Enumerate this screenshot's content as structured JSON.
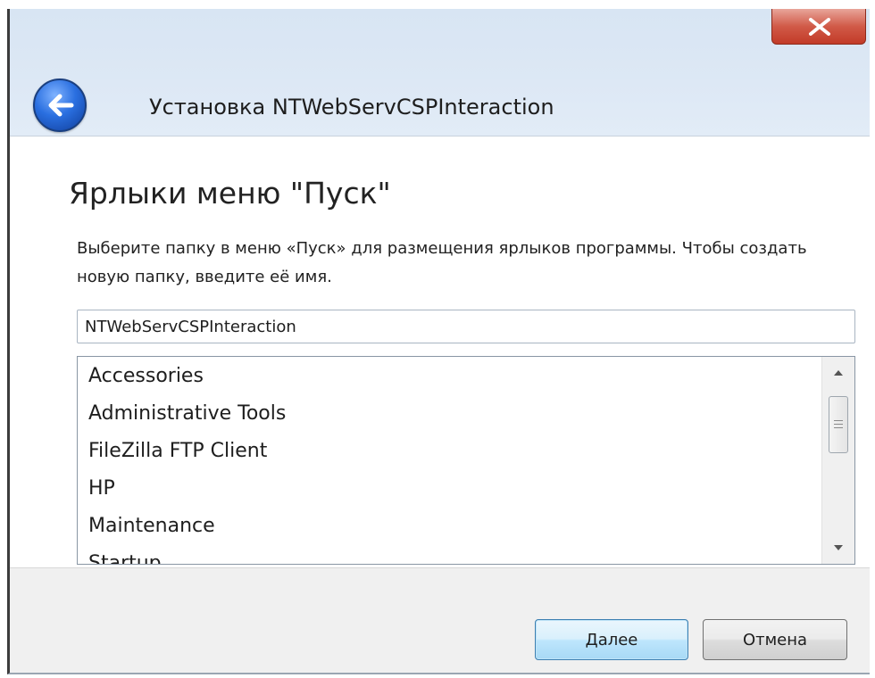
{
  "window": {
    "title": "Установка NTWebServCSPInteraction",
    "close_glyph": "x",
    "back_icon": "back-arrow-icon"
  },
  "page": {
    "heading": "Ярлыки меню \"Пуск\"",
    "instructions": "Выберите папку в меню «Пуск» для размещения ярлыков программы. Чтобы создать новую папку, введите её имя."
  },
  "folder_input": {
    "value": "NTWebServCSPInteraction"
  },
  "folder_list": {
    "items": [
      "Accessories",
      "Administrative Tools",
      "FileZilla FTP Client",
      "HP",
      "Maintenance",
      "Startup"
    ],
    "scroll_up_icon": "scroll-up-arrow-icon",
    "scroll_down_icon": "scroll-down-arrow-icon"
  },
  "buttons": {
    "next_label": "Далее",
    "cancel_label": "Отмена"
  }
}
